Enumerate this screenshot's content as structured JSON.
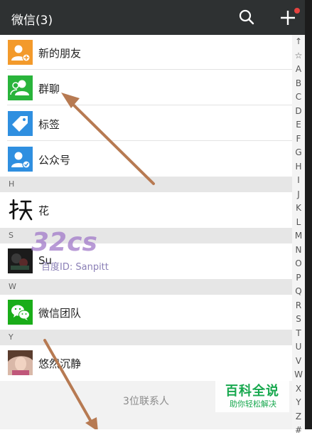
{
  "header": {
    "title": "微信(3)",
    "search_icon": "search-icon",
    "add_icon": "plus-icon",
    "badge_color": "#e64340"
  },
  "features": [
    {
      "label": "新的朋友",
      "icon": "new-friend-icon",
      "color": "#f39a2b"
    },
    {
      "label": "群聊",
      "icon": "group-chat-icon",
      "color": "#29b43b"
    },
    {
      "label": "标签",
      "icon": "tag-icon",
      "color": "#2f8fe0"
    },
    {
      "label": "公众号",
      "icon": "official-account-icon",
      "color": "#2f8fe0"
    }
  ],
  "sections": [
    {
      "letter": "H",
      "contacts": [
        {
          "name": "花"
        }
      ]
    },
    {
      "letter": "S",
      "contacts": [
        {
          "name": "Su"
        }
      ]
    },
    {
      "letter": "W",
      "contacts": [
        {
          "name": "微信团队"
        }
      ]
    },
    {
      "letter": "Y",
      "contacts": [
        {
          "name": "悠然沉静"
        }
      ]
    }
  ],
  "footer": {
    "count": "3位联系人"
  },
  "index_letters": [
    "↑",
    "☆",
    "A",
    "B",
    "C",
    "D",
    "E",
    "F",
    "G",
    "H",
    "I",
    "J",
    "K",
    "L",
    "M",
    "N",
    "O",
    "P",
    "Q",
    "R",
    "S",
    "T",
    "U",
    "V",
    "W",
    "X",
    "Y",
    "Z",
    "#"
  ],
  "watermarks": {
    "logo_title": "百科全说",
    "logo_subtitle": "助你轻松解决",
    "site_id": "百度ID: Sanpitt",
    "site_brand": "32cs"
  }
}
